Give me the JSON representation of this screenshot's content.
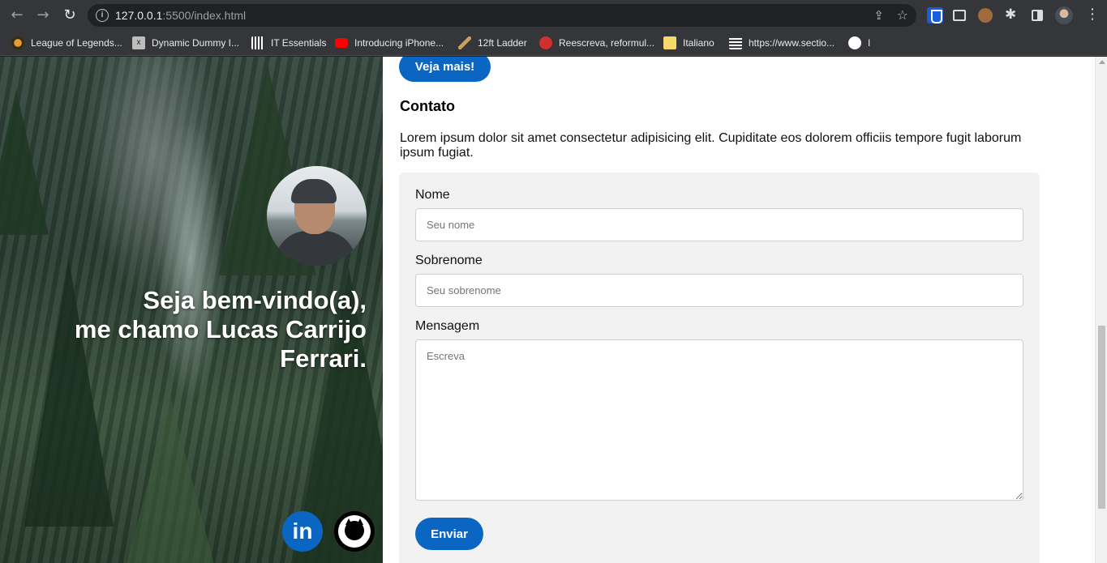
{
  "browser": {
    "url_host": "127.0.0.1",
    "url_rest": ":5500/index.html",
    "bookmarks": [
      "League of Legends...",
      "Dynamic Dummy I...",
      "IT Essentials",
      "Introducing iPhone...",
      "12ft Ladder",
      "Reescreva, reformul...",
      "Italiano",
      "https://www.sectio...",
      "I"
    ]
  },
  "hero": {
    "greeting_line1": "Seja bem-vindo(a),",
    "greeting_line2": "me chamo Lucas Carrijo",
    "greeting_line3": "Ferrari.",
    "linkedin_text": "in"
  },
  "content": {
    "see_more_label": "Veja mais!",
    "contact_title": "Contato",
    "contact_text": "Lorem ipsum dolor sit amet consectetur adipisicing elit. Cupiditate eos dolorem officiis tempore fugit laborum ipsum fugiat.",
    "form": {
      "first_name_label": "Nome",
      "first_name_placeholder": "Seu nome",
      "last_name_label": "Sobrenome",
      "last_name_placeholder": "Seu sobrenome",
      "message_label": "Mensagem",
      "message_placeholder": "Escreva",
      "submit_label": "Enviar"
    }
  },
  "colors": {
    "accent": "#0a66c2",
    "form_bg": "#f2f2f2"
  }
}
